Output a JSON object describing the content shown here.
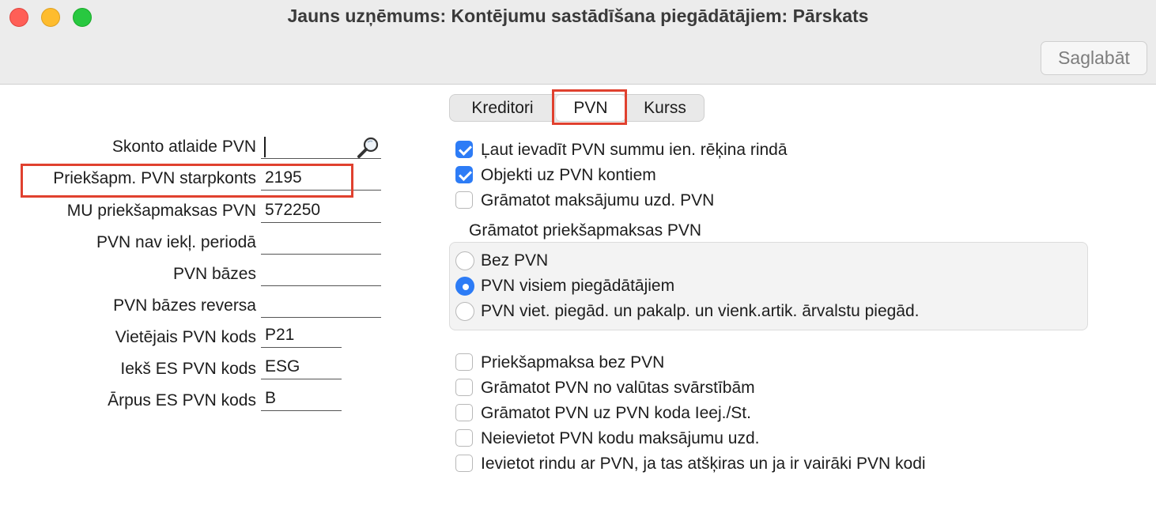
{
  "window": {
    "title": "Jauns uzņēmums: Kontējumu sastādīšana piegādātājiem: Pārskats",
    "save_label": "Saglabāt"
  },
  "tabs": [
    {
      "label": "Kreditori",
      "selected": false
    },
    {
      "label": "PVN",
      "selected": true
    },
    {
      "label": "Kurss",
      "selected": false
    }
  ],
  "fields": [
    {
      "label": "Skonto atlaide PVN",
      "value": ""
    },
    {
      "label": "Priekšapm. PVN starpkonts",
      "value": "2195"
    },
    {
      "label": "MU priekšapmaksas PVN",
      "value": "572250"
    },
    {
      "label": "PVN nav iekļ. periodā",
      "value": ""
    },
    {
      "label": "PVN bāzes",
      "value": ""
    },
    {
      "label": "PVN bāzes reversa",
      "value": ""
    },
    {
      "label": "Vietējais PVN kods",
      "value": "P21"
    },
    {
      "label": "Iekš ES PVN kods",
      "value": "ESG"
    },
    {
      "label": "Ārpus ES PVN kods",
      "value": "B"
    }
  ],
  "checkboxes_top": [
    {
      "label": "Ļaut ievadīt PVN summu ien. rēķina rindā",
      "checked": true
    },
    {
      "label": "Objekti uz PVN kontiem",
      "checked": true
    },
    {
      "label": "Grāmatot maksājumu uzd. PVN",
      "checked": false
    }
  ],
  "radio_group": {
    "title": "Grāmatot priekšapmaksas PVN",
    "options": [
      {
        "label": "Bez PVN",
        "selected": false
      },
      {
        "label": "PVN visiem piegādātājiem",
        "selected": true
      },
      {
        "label": "PVN viet. piegād. un pakalp. un vienk.artik. ārvalstu piegād.",
        "selected": false
      }
    ]
  },
  "checkboxes_bottom": [
    {
      "label": "Priekšapmaksa bez PVN",
      "checked": false
    },
    {
      "label": "Grāmatot PVN no valūtas svārstībām",
      "checked": false
    },
    {
      "label": "Grāmatot PVN uz PVN koda Ieej./St.",
      "checked": false
    },
    {
      "label": "Neievietot PVN kodu maksājumu uzd.",
      "checked": false
    },
    {
      "label": "Ievietot rindu ar PVN, ja tas atšķiras un ja ir vairāki PVN kodi",
      "checked": false
    }
  ],
  "colors": {
    "accent": "#2d7cf6",
    "highlight": "#e0412f"
  }
}
